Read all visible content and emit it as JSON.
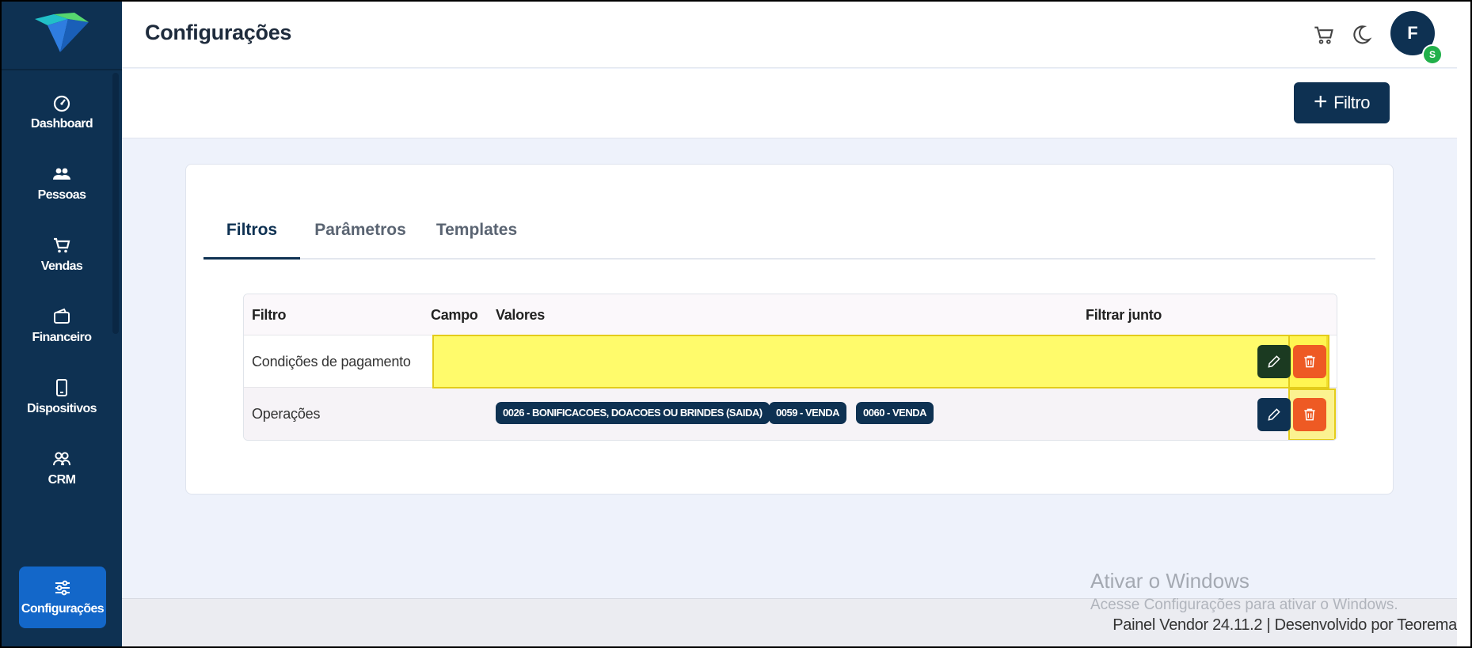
{
  "header": {
    "title": "Configurações",
    "avatar_initial": "F",
    "avatar_badge": "S"
  },
  "sidebar": {
    "items": [
      {
        "label": "Dashboard",
        "icon": "gauge-icon"
      },
      {
        "label": "Pessoas",
        "icon": "people-icon"
      },
      {
        "label": "Vendas",
        "icon": "cart-icon"
      },
      {
        "label": "Financeiro",
        "icon": "wallet-icon"
      },
      {
        "label": "Dispositivos",
        "icon": "phone-icon"
      },
      {
        "label": "CRM",
        "icon": "users-icon"
      }
    ],
    "active_item": {
      "label": "Configurações",
      "icon": "sliders-icon"
    }
  },
  "toolbar": {
    "filter_button_label": "Filtro"
  },
  "tabs": [
    "Filtros",
    "Parâmetros",
    "Templates"
  ],
  "table": {
    "columns": [
      "Filtro",
      "Campo",
      "Valores",
      "Filtrar junto"
    ],
    "rows": [
      {
        "filtro": "Condições de pagamento",
        "campo": "",
        "valores": []
      },
      {
        "filtro": "Operações",
        "campo": "",
        "valores": [
          "0026 - BONIFICACOES, DOACOES OU BRINDES (SAIDA)",
          "0059 - VENDA",
          "0060 - VENDA"
        ]
      }
    ]
  },
  "watermark": {
    "title": "Ativar o Windows",
    "subtitle": "Acesse Configurações para ativar o Windows."
  },
  "footer": {
    "text": "Painel Vendor  24.11.2  |  Desenvolvido por Teorema"
  },
  "colors": {
    "sidebar": "#0e3152",
    "accent": "#1367c9",
    "delete": "#ee5a24",
    "highlight": "#fffb6b"
  }
}
